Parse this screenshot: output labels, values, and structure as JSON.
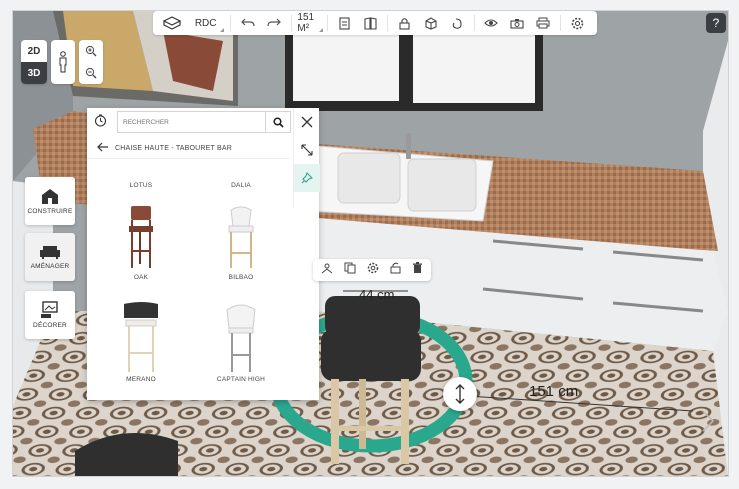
{
  "toolbar": {
    "level": "RDC",
    "area": "151 M²",
    "icons": [
      "3d-box-icon",
      "undo-icon",
      "redo-icon",
      "floor-plan-icon",
      "catalog-book-icon",
      "lock-icon",
      "texture-cube-icon",
      "material-swirl-icon",
      "eye-icon",
      "camera-icon",
      "print-icon",
      "settings-icon"
    ]
  },
  "help": {
    "label": "?"
  },
  "view": {
    "two_d": "2D",
    "three_d": "3D",
    "active": "3D"
  },
  "modes": [
    {
      "label": "CONSTRUIRE"
    },
    {
      "label": "AMÉNAGER"
    },
    {
      "label": "DÉCORER"
    }
  ],
  "catalog": {
    "search_placeholder": "RECHERCHER",
    "category": "CHAISE HAUTE - TABOURET BAR",
    "products": [
      {
        "name": "LOTUS"
      },
      {
        "name": "DALIA"
      },
      {
        "name": "OAK"
      },
      {
        "name": "BILBAO"
      },
      {
        "name": "MERANO"
      },
      {
        "name": "CAPTAIN HIGH"
      }
    ]
  },
  "dimensions": {
    "depth": "44 cm",
    "width": "151 cm"
  },
  "colors": {
    "accent": "#2aa88d",
    "dark": "#3b3e42",
    "counter": "#a67859"
  }
}
